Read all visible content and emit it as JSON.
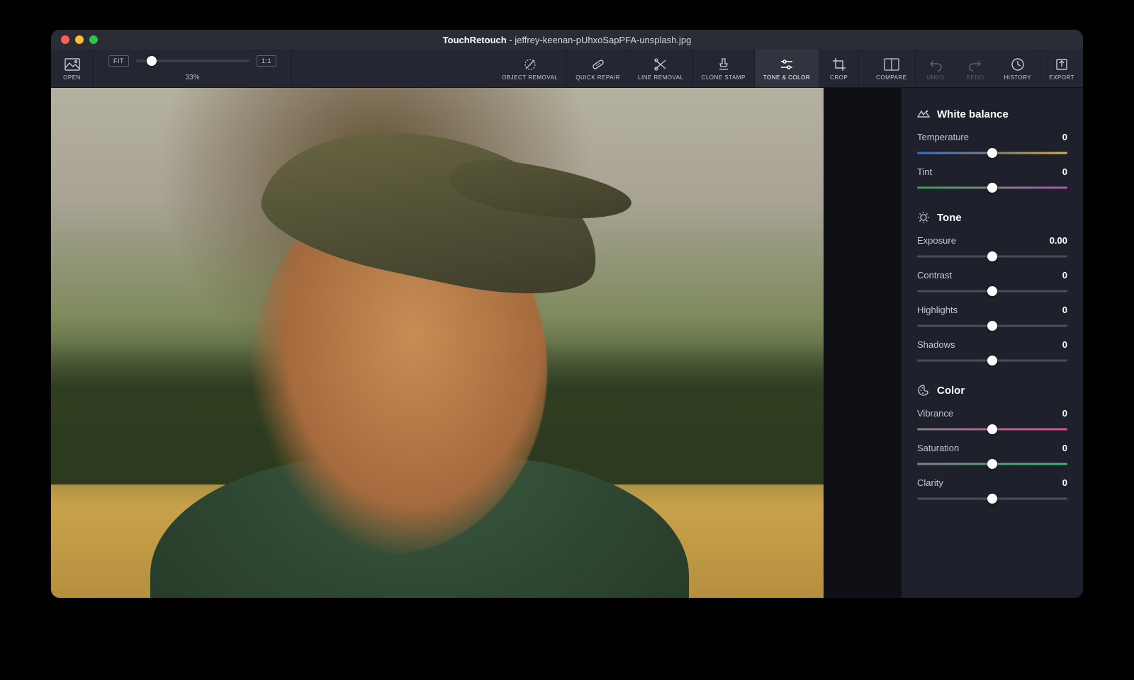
{
  "titlebar": {
    "app_name": "TouchRetouch",
    "separator": " - ",
    "filename": "jeffrey-keenan-pUhxoSapPFA-unsplash.jpg"
  },
  "toolbar": {
    "open_label": "OPEN",
    "fit_label": "FIT",
    "one_to_one_label": "1:1",
    "zoom_pct": "33%",
    "tools": {
      "object_removal": "OBJECT REMOVAL",
      "quick_repair": "QUICK REPAIR",
      "line_removal": "LINE REMOVAL",
      "clone_stamp": "CLONE STAMP",
      "tone_color": "TONE & COLOR",
      "crop": "CROP"
    },
    "right": {
      "compare": "COMPARE",
      "undo": "UNDO",
      "redo": "REDO",
      "history": "HISTORY",
      "export": "EXPORT"
    }
  },
  "panel": {
    "white_balance": {
      "title": "White balance",
      "temperature": {
        "label": "Temperature",
        "value": "0"
      },
      "tint": {
        "label": "Tint",
        "value": "0"
      }
    },
    "tone": {
      "title": "Tone",
      "exposure": {
        "label": "Exposure",
        "value": "0.00"
      },
      "contrast": {
        "label": "Contrast",
        "value": "0"
      },
      "highlights": {
        "label": "Highlights",
        "value": "0"
      },
      "shadows": {
        "label": "Shadows",
        "value": "0"
      }
    },
    "color": {
      "title": "Color",
      "vibrance": {
        "label": "Vibrance",
        "value": "0"
      },
      "saturation": {
        "label": "Saturation",
        "value": "0"
      },
      "clarity": {
        "label": "Clarity",
        "value": "0"
      }
    }
  }
}
